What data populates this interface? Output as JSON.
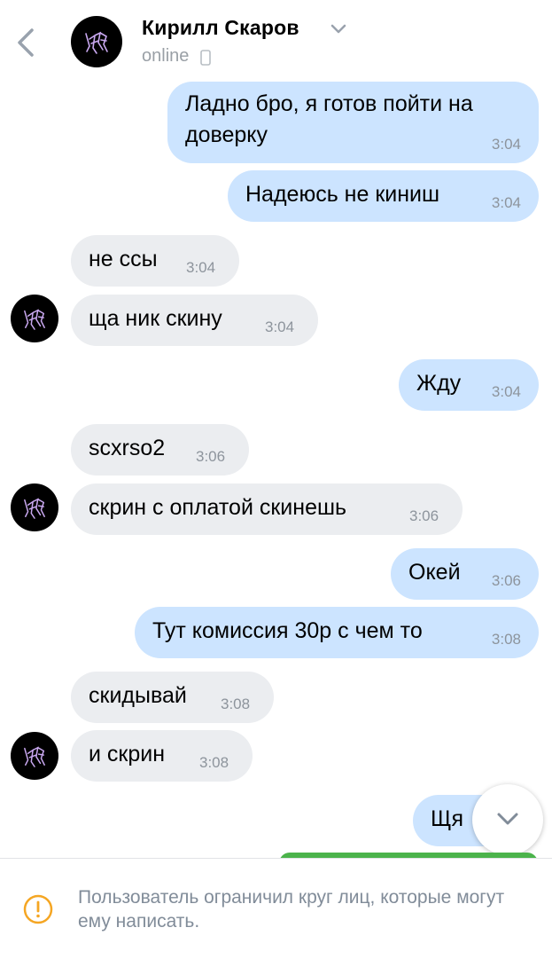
{
  "header": {
    "name": "Кирилл Скаров",
    "status": "online"
  },
  "messages": [
    {
      "direction": "out",
      "lines": [
        "Ладно бро, я готов пойти на",
        "доверку"
      ],
      "time": "3:04"
    },
    {
      "direction": "out",
      "text": "Надеюсь не киниш",
      "time": "3:04"
    },
    {
      "direction": "in",
      "text": "не ссы",
      "time": "3:04"
    },
    {
      "direction": "in",
      "text": "ща ник скину",
      "time": "3:04"
    },
    {
      "direction": "out",
      "text": "Жду",
      "time": "3:04"
    },
    {
      "direction": "in",
      "text": "scxrso2",
      "time": "3:06"
    },
    {
      "direction": "in",
      "text": "скрин с оплатой скинешь",
      "time": "3:06"
    },
    {
      "direction": "out",
      "text": "Окей",
      "time": "3:06"
    },
    {
      "direction": "out",
      "text": "Тут комиссия 30р с чем то",
      "time": "3:08"
    },
    {
      "direction": "in",
      "text": "скидывай",
      "time": "3:08"
    },
    {
      "direction": "in",
      "text": "и скрин",
      "time": "3:08"
    },
    {
      "direction": "out",
      "text": "Щя",
      "time": ""
    }
  ],
  "footer": {
    "notice": "Пользователь ограничил круг лиц, которые могут ему написать."
  },
  "colors": {
    "outgoing_bubble": "#cce4ff",
    "incoming_bubble": "#ebedf0",
    "avatar_bg": "#000000",
    "avatar_art": "#c9a8f0",
    "warning": "#f5a623"
  },
  "icons": {
    "back": "chevron-left-icon",
    "dropdown": "chevron-down-icon",
    "device": "phone-icon",
    "scroll_down": "chevron-down-icon",
    "warning": "exclamation-circle-icon"
  }
}
